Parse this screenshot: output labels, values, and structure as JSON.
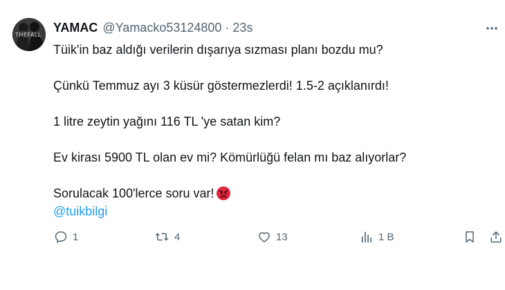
{
  "author": {
    "display_name": "YAMAC",
    "handle": "@Yamacko53124800",
    "separator": "·",
    "time": "23s",
    "avatar_icon": "profile-photo-thefall",
    "avatar_text": "THEFALL"
  },
  "tweet": {
    "paragraphs": [
      "Tüik'in baz aldığı verilerin dışarıya sızması planı bozdu mu?",
      "Çünkü Temmuz ayı 3 küsür göstermezlerdi! 1.5-2 açıklanırdı!",
      "1 litre zeytin yağını 116 TL 'ye satan kim?",
      "Ev kirası 5900 TL olan ev mi? Kömürlüğü felan mı baz alıyorlar?",
      "Sorulacak 100'lerce soru var!"
    ],
    "emoji": "angry-face-emoji",
    "mention": "@tuikbilgi"
  },
  "actions": {
    "reply_count": "1",
    "retweet_count": "4",
    "like_count": "13",
    "views_count": "1 B"
  },
  "colors": {
    "text": "#0f1419",
    "secondary": "#536471",
    "link": "#1d9bf0",
    "emoji_red": "#e0263c"
  }
}
